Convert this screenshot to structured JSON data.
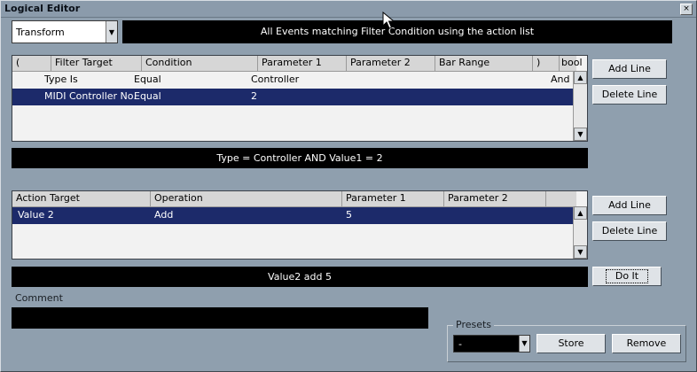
{
  "window": {
    "title": "Logical Editor",
    "close_label": "×"
  },
  "top": {
    "mode_value": "Transform",
    "mode_caption": "All Events matching Filter Condition using the action list"
  },
  "filter": {
    "headers": [
      "(",
      "Filter Target",
      "Condition",
      "Parameter 1",
      "Parameter 2",
      "Bar Range",
      ")",
      "bool"
    ],
    "rows": [
      {
        "c0": "",
        "c1": "Type Is",
        "c2": "Equal",
        "c3": "Controller",
        "c4": "",
        "c5": "",
        "c6": "",
        "c7": "And",
        "selected": false
      },
      {
        "c0": "",
        "c1": "MIDI Controller No.",
        "c2": "Equal",
        "c3": "2",
        "c4": "",
        "c5": "",
        "c6": "",
        "c7": "",
        "selected": true
      }
    ],
    "summary": "Type = Controller  AND    Value1 = 2",
    "add_line": "Add Line",
    "delete_line": "Delete Line"
  },
  "action": {
    "headers": [
      "Action Target",
      "Operation",
      "Parameter 1",
      "Parameter 2"
    ],
    "rows": [
      {
        "c0": "Value 2",
        "c1": "Add",
        "c2": "5",
        "c3": "",
        "selected": true
      }
    ],
    "summary": "Value2 add 5",
    "add_line": "Add Line",
    "delete_line": "Delete Line",
    "do_it": "Do It"
  },
  "comment": {
    "label": "Comment",
    "value": ""
  },
  "presets": {
    "label": "Presets",
    "selected": "-",
    "store": "Store",
    "remove": "Remove"
  },
  "icons": {
    "scroll_up": "scroll-up-arrow-icon",
    "scroll_down": "scroll-down-arrow-icon",
    "dropdown": "chevron-down-icon",
    "cursor": "mouse-pointer-icon"
  },
  "colors": {
    "window_bg": "#8f9fae",
    "selection": "#1c2a6a",
    "bar_black": "#000000"
  }
}
